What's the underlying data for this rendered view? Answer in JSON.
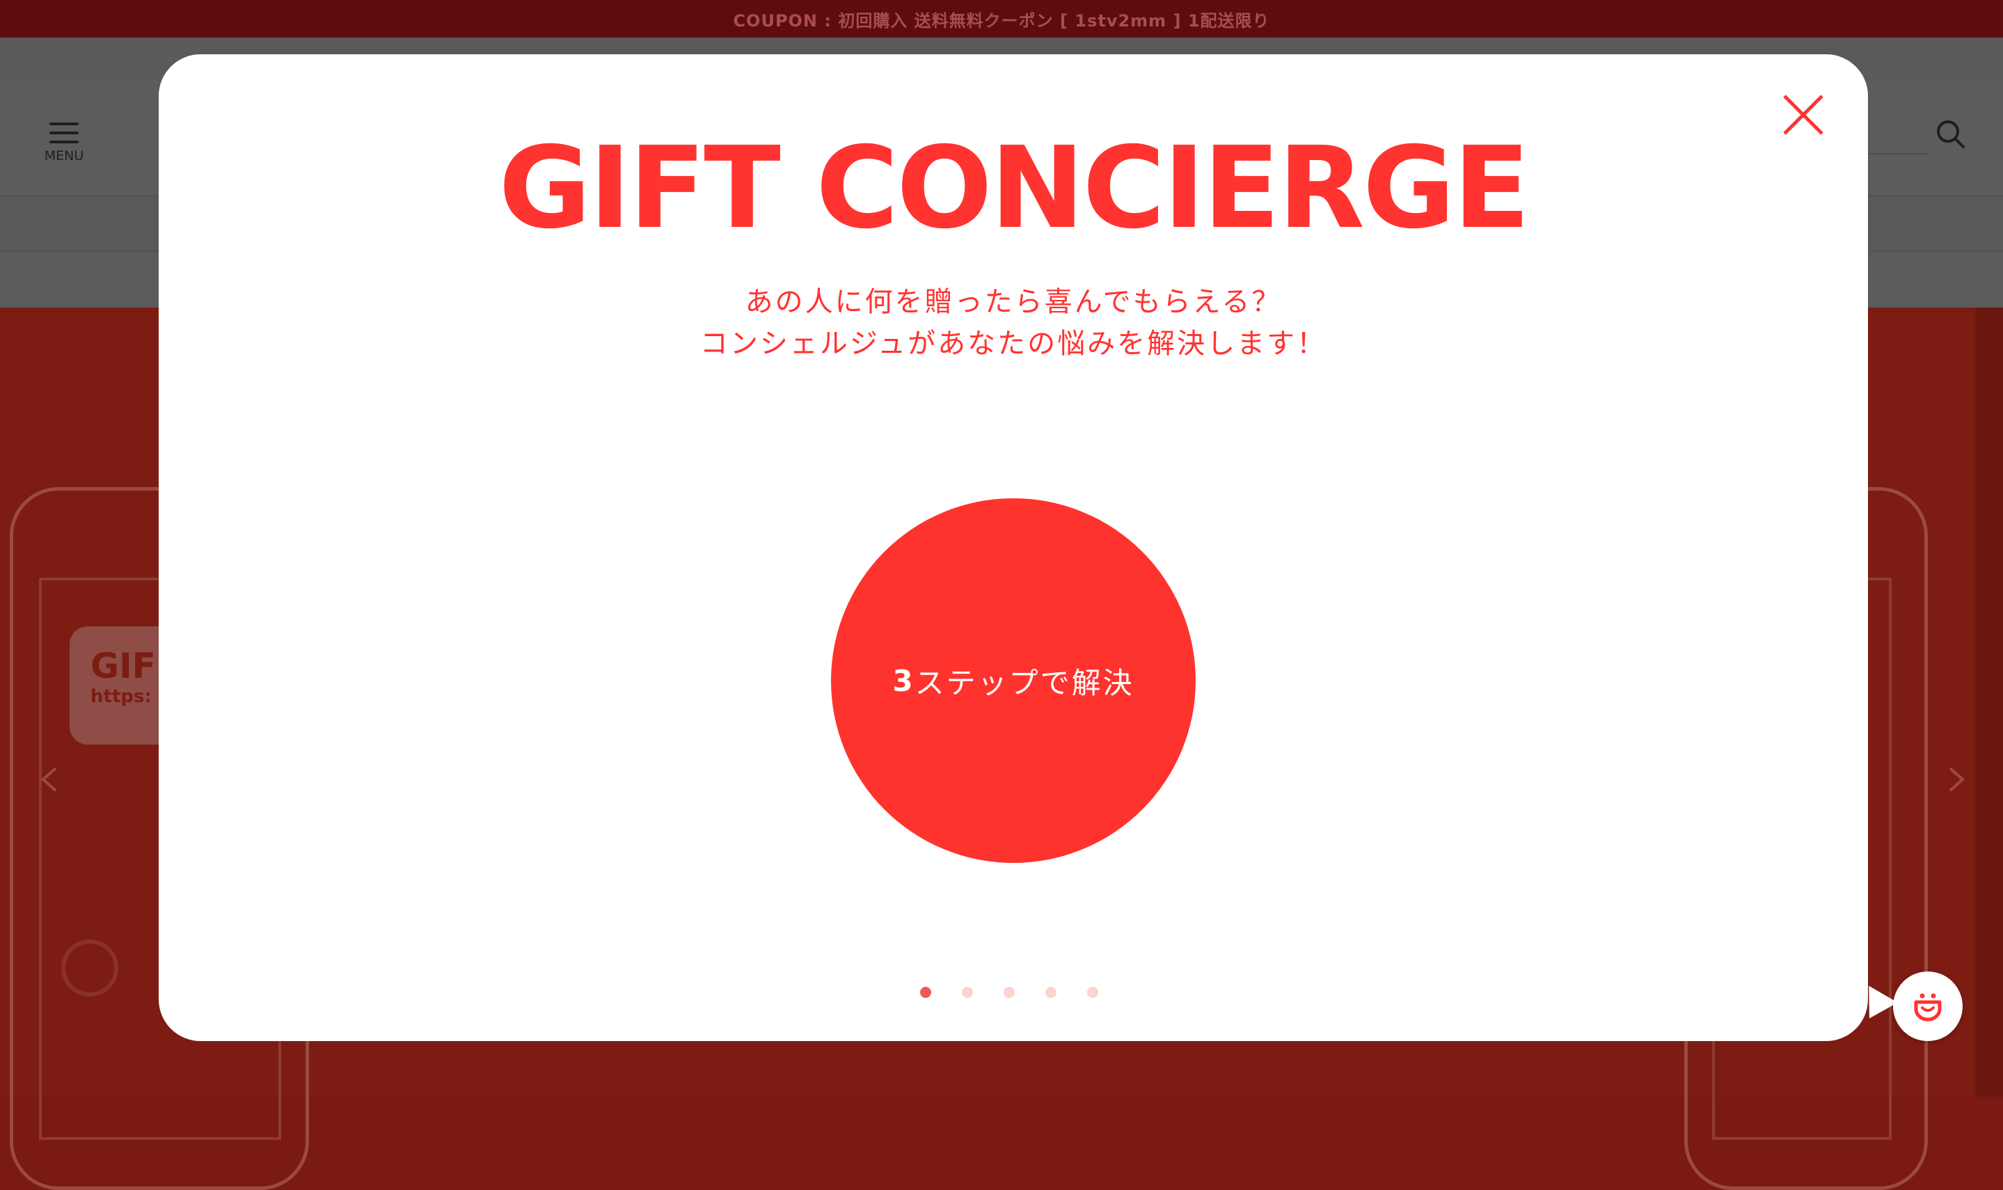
{
  "background": {
    "coupon_bar": "COUPON : 初回購入 送料無料クーポン [ 1stv2mm ] 1配送限り",
    "menu_label": "MENU",
    "hero_card": {
      "title": "GIF",
      "url": "https:"
    }
  },
  "modal": {
    "title": "GIFT CONCIERGE",
    "subtitle_line1": "あの人に何を贈ったら喜んでもらえる？",
    "subtitle_line2": "コンシェルジュがあなたの悩みを解決します！",
    "cta_number": "3",
    "cta_text": "ステップで解決",
    "pagination": {
      "total": 5,
      "active": 0
    }
  },
  "colors": {
    "accent": "#ff3330",
    "coupon_bar": "#5e0d0d",
    "dot_active": "#f0595a",
    "dot_inactive": "#fcd3d1"
  },
  "icons": [
    "hamburger-menu-icon",
    "search-icon",
    "close-icon",
    "chevron-left-icon",
    "chevron-right-icon",
    "chat-smile-icon"
  ]
}
